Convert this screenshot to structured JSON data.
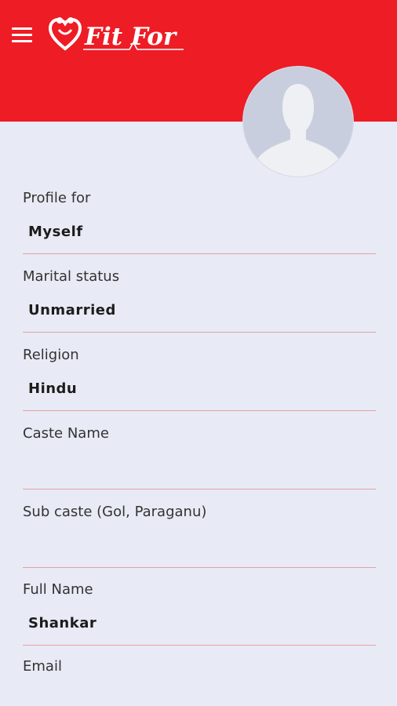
{
  "app": {
    "name": "Fit For",
    "brand_color": "#ee1c25",
    "background_color": "#e8ebf5",
    "divider_color": "#e2a1a4"
  },
  "header": {
    "menu_icon": "hamburger-menu-icon",
    "logo_icon": "heart-couple-icon",
    "logo_text": "Fit For",
    "avatar_icon": "default-avatar-icon"
  },
  "form": {
    "fields": [
      {
        "label": "Profile for",
        "value": "Myself"
      },
      {
        "label": "Marital status",
        "value": "Unmarried"
      },
      {
        "label": "Religion",
        "value": "Hindu"
      },
      {
        "label": "Caste Name",
        "value": ""
      },
      {
        "label": "Sub caste (Gol, Paraganu)",
        "value": ""
      },
      {
        "label": "Full Name",
        "value": "Shankar"
      },
      {
        "label": "Email",
        "value": ""
      }
    ]
  }
}
